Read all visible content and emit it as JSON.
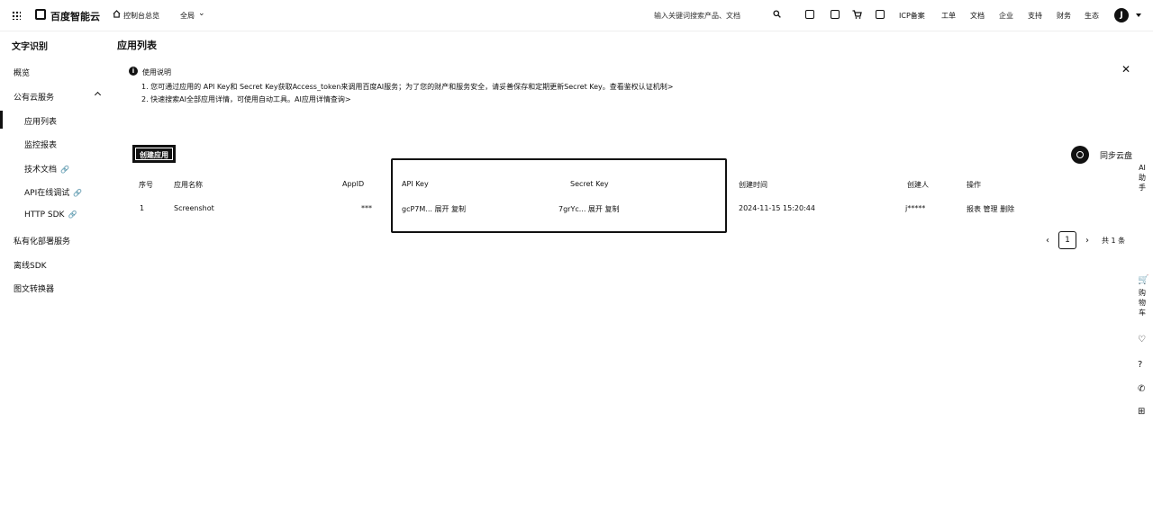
{
  "topbar": {
    "logo": "百度智能云",
    "nav": [
      {
        "label": "控制台总览"
      },
      {
        "label": "全局"
      }
    ],
    "search_placeholder": "输入关键词搜索产品、文档",
    "links": [
      "ICP备案",
      "工单",
      "文档",
      "企业",
      "支持",
      "财务",
      "生态"
    ],
    "avatar_initial": "J"
  },
  "sidebar": {
    "title": "文字识别",
    "items": [
      {
        "label": "概览"
      },
      {
        "label": "公有云服务"
      },
      {
        "label": "应用列表"
      },
      {
        "label": "监控报表"
      },
      {
        "label": "技术文档"
      },
      {
        "label": "API在线调试"
      },
      {
        "label": "HTTP SDK"
      },
      {
        "label": "私有化部署服务"
      },
      {
        "label": "离线SDK"
      },
      {
        "label": "图文转换器"
      }
    ]
  },
  "main": {
    "title": "应用列表",
    "notice": {
      "title": "使用说明",
      "lines": [
        "1. 您可通过应用的 API Key和 Secret Key获取Access_token来调用百度AI服务；为了您的财产和服务安全，请妥善保存和定期更新Secret Key。查看鉴权认证机制>",
        "2. 快速搜索AI全部应用详情，可使用自动工具。AI应用详情查询>"
      ]
    },
    "create_button": "创建应用",
    "cloud_label": "同步云盘",
    "table": {
      "headers": [
        "序号",
        "应用名称",
        "AppID",
        "API Key",
        "Secret Key",
        "创建时间",
        "创建人",
        "操作"
      ],
      "rows": [
        {
          "index": "1",
          "name": "Screenshot",
          "appid": "***",
          "api_key": "gcP7M... 展开 复制",
          "secret_key": "7grYc... 展开 复制",
          "created": "2024-11-15 15:20:44",
          "creator": "j*****",
          "actions": "报表  管理  删除"
        }
      ]
    },
    "pager": {
      "current": "1",
      "total": "共 1 条"
    }
  },
  "float_bar": {
    "ai_assist": "AI助手",
    "cart": "购物车"
  }
}
